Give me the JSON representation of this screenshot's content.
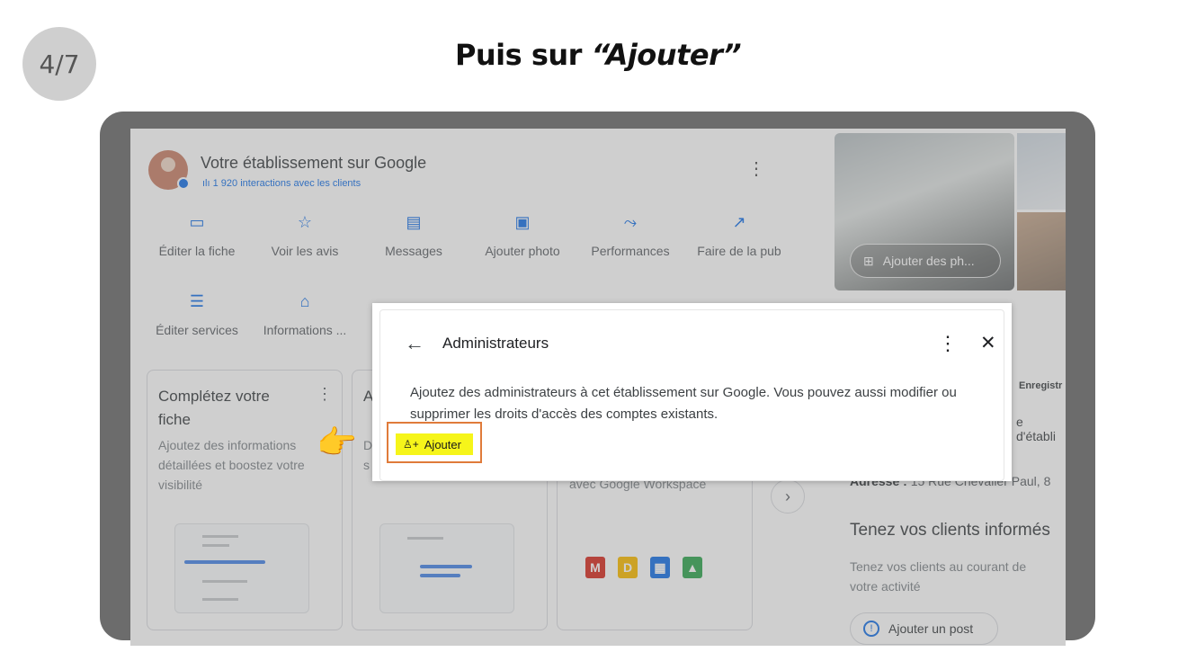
{
  "step_badge": "4/7",
  "heading": {
    "prefix": "Puis sur ",
    "emphasis": "“Ajouter”"
  },
  "business": {
    "title": "Votre établissement sur Google",
    "interactions": "1 920 interactions avec les clients",
    "actions_row1": [
      "Éditer la fiche",
      "Voir les avis",
      "Messages",
      "Ajouter photo",
      "Performances",
      "Faire de la pub"
    ],
    "actions_row2": [
      "Éditer services",
      "Informations ..."
    ],
    "add_photos": "Ajouter des ph...",
    "card1": {
      "title": "Complétez votre fiche",
      "body": "Ajoutez des informations détaillées et boostez votre visibilité"
    },
    "card2_initial": "A",
    "card2_body_initial": "D",
    "card2_body_initial2": "s",
    "card3_text": "avec Google Workspace",
    "right_label": "Enregistr",
    "right_label2": "e d'établi",
    "address_label": "Adresse :",
    "address_value": "15 Rue Chevalier Paul, 8",
    "inform_title": "Tenez vos clients informés",
    "inform_body": "Tenez vos clients au courant de votre activité",
    "add_post": "Ajouter un post"
  },
  "dialog": {
    "title": "Administrateurs",
    "description": "Ajoutez des administrateurs à cet établissement sur Google. Vous pouvez aussi modifier ou supprimer les droits d'accès des comptes existants.",
    "add_button": "Ajouter"
  },
  "colors": {
    "google_blue": "#1a73e8",
    "highlight": "#f6f51a",
    "highlight_border": "#e07b3a",
    "frame": "#6c6c6c"
  }
}
